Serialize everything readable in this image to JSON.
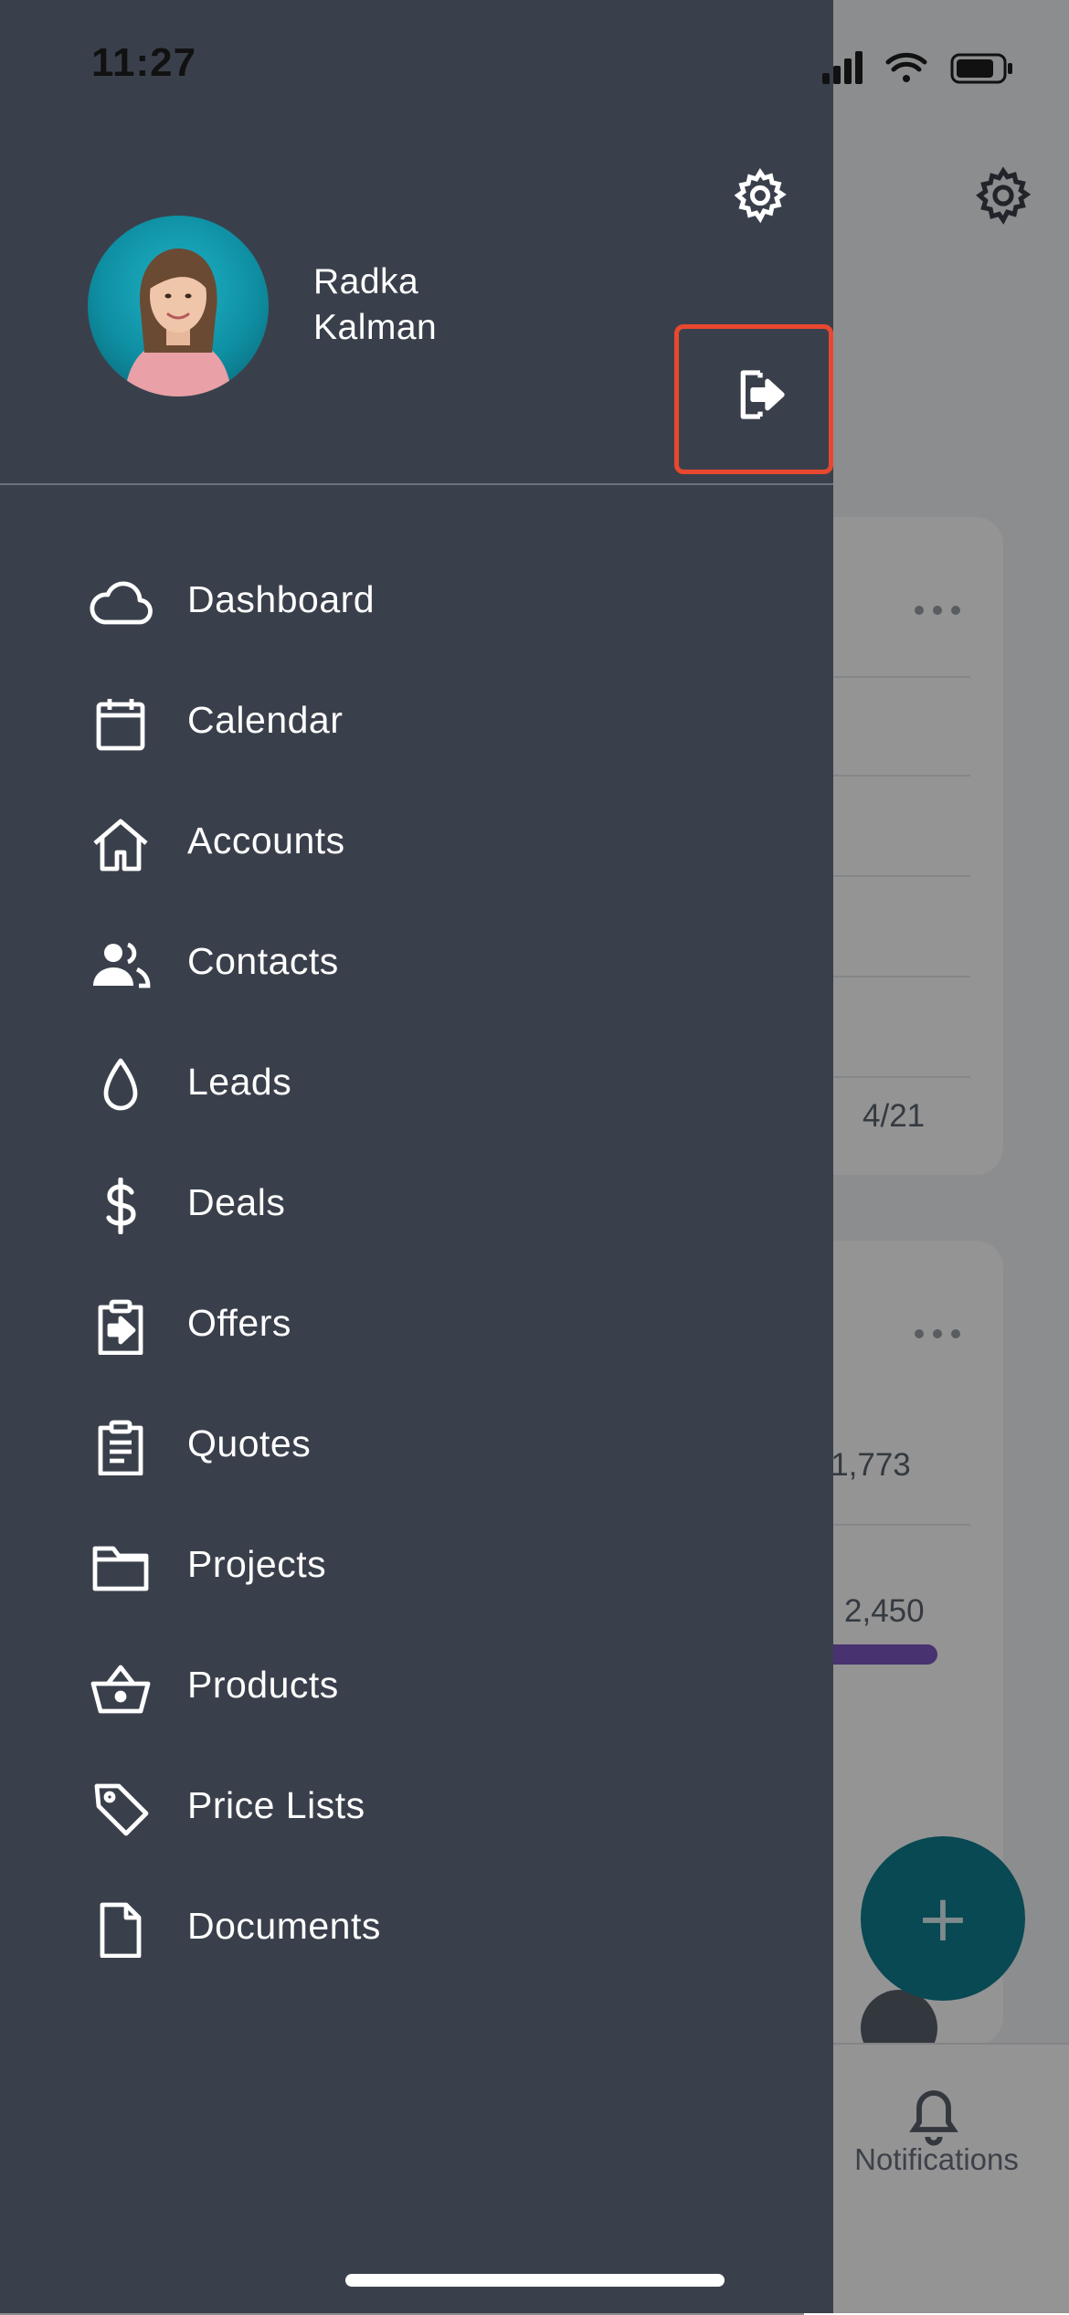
{
  "status_bar": {
    "time": "11:27"
  },
  "user": {
    "first_name": "Radka",
    "last_name": "Kalman"
  },
  "drawer": {
    "items": [
      {
        "label": "Dashboard",
        "icon": "cloud-icon"
      },
      {
        "label": "Calendar",
        "icon": "calendar-icon"
      },
      {
        "label": "Accounts",
        "icon": "home-icon"
      },
      {
        "label": "Contacts",
        "icon": "people-icon"
      },
      {
        "label": "Leads",
        "icon": "drop-icon"
      },
      {
        "label": "Deals",
        "icon": "dollar-icon"
      },
      {
        "label": "Offers",
        "icon": "offer-icon"
      },
      {
        "label": "Quotes",
        "icon": "clipboard-icon"
      },
      {
        "label": "Projects",
        "icon": "folder-icon"
      },
      {
        "label": "Products",
        "icon": "basket-icon"
      },
      {
        "label": "Price Lists",
        "icon": "tag-icon"
      },
      {
        "label": "Documents",
        "icon": "document-icon"
      }
    ]
  },
  "background": {
    "card1_footer": "4/21",
    "card2_value1": "$ 1,773",
    "card2_value2": "2,450",
    "tab_notifications": "Notifications",
    "fab_label": "+"
  },
  "colors": {
    "drawer_bg": "#3a404b",
    "highlight": "#e8482f",
    "fab": "#0f7f8f",
    "progress": "#7e57c2"
  }
}
